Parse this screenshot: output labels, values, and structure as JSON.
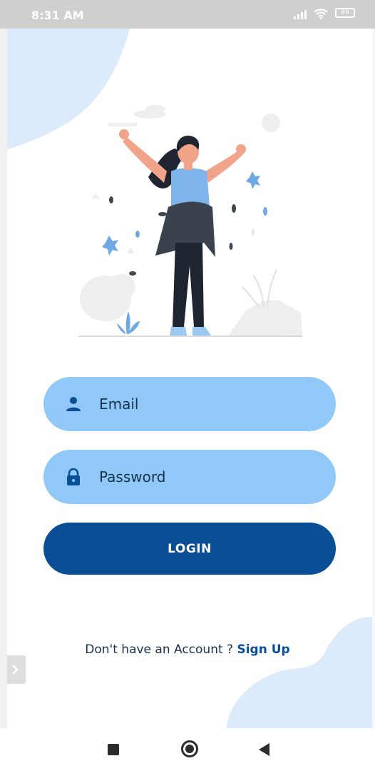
{
  "status_bar": {
    "time": "8:31 AM",
    "battery": "89",
    "icons": [
      "signal-icon",
      "wifi-icon",
      "battery-icon"
    ]
  },
  "illustration": {
    "icon": "woman-celebrating-illustration"
  },
  "login_form": {
    "email_label": "Email",
    "email_icon": "person-icon",
    "password_label": "Password",
    "password_icon": "lock-icon",
    "login_button": "LOGIN"
  },
  "signup": {
    "prompt": "Don't have an Account ?",
    "link": "Sign Up"
  },
  "nav_bar": {
    "icons": [
      "recents-square-icon",
      "home-circle-icon",
      "back-triangle-icon"
    ]
  },
  "colors": {
    "field_bg": "#90c8f8",
    "primary": "#0a4e96",
    "blob": "#dcebfb",
    "text_dark": "#17324d"
  }
}
